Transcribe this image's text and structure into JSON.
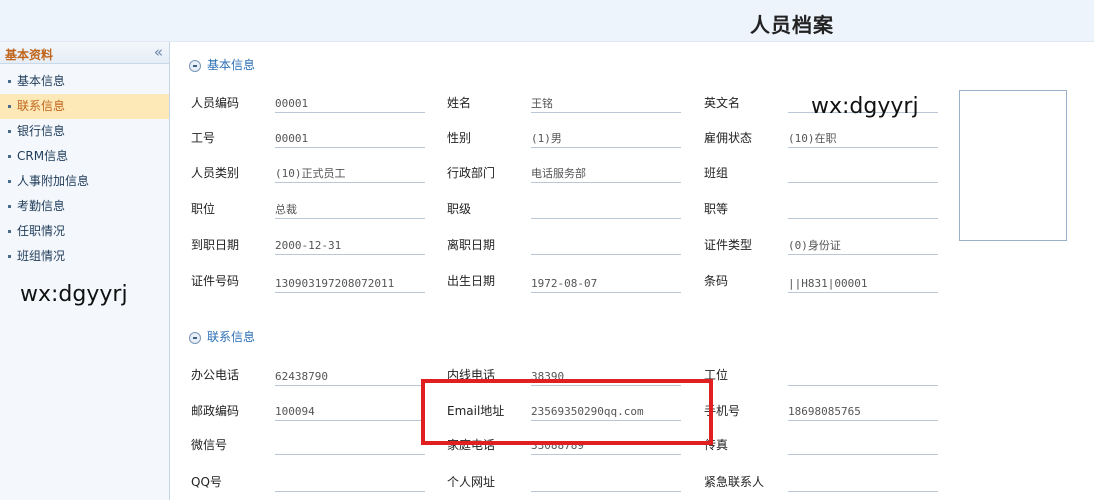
{
  "header": {
    "title": "人员档案"
  },
  "sidebar": {
    "title": "基本资料",
    "collapse_icon": "«",
    "items": [
      {
        "label": "基本信息",
        "active": false
      },
      {
        "label": "联系信息",
        "active": true
      },
      {
        "label": "银行信息",
        "active": false
      },
      {
        "label": "CRM信息",
        "active": false
      },
      {
        "label": "人事附加信息",
        "active": false
      },
      {
        "label": "考勤信息",
        "active": false
      },
      {
        "label": "任职情况",
        "active": false
      },
      {
        "label": "班组情况",
        "active": false
      }
    ],
    "watermark": "wx:dgyyrj"
  },
  "main": {
    "watermark": "wx:dgyyrj",
    "basic": {
      "title": "基本信息",
      "fields": {
        "emp_code": {
          "label": "人员编码",
          "value": "00001"
        },
        "name": {
          "label": "姓名",
          "value": "王铭"
        },
        "en_name": {
          "label": "英文名",
          "value": ""
        },
        "job_no": {
          "label": "工号",
          "value": "00001"
        },
        "gender": {
          "label": "性别",
          "value": "(1)男"
        },
        "emp_status": {
          "label": "雇佣状态",
          "value": "(10)在职"
        },
        "emp_type": {
          "label": "人员类别",
          "value": "(10)正式员工"
        },
        "dept": {
          "label": "行政部门",
          "value": "电话服务部"
        },
        "team": {
          "label": "班组",
          "value": ""
        },
        "position": {
          "label": "职位",
          "value": "总裁"
        },
        "rank": {
          "label": "职级",
          "value": ""
        },
        "grade": {
          "label": "职等",
          "value": ""
        },
        "hire_date": {
          "label": "到职日期",
          "value": "2000-12-31"
        },
        "leave_date": {
          "label": "离职日期",
          "value": ""
        },
        "id_type": {
          "label": "证件类型",
          "value": "(0)身份证"
        },
        "id_no": {
          "label": "证件号码",
          "value": "130903197208072011"
        },
        "birth": {
          "label": "出生日期",
          "value": "1972-08-07"
        },
        "barcode": {
          "label": "条码",
          "value": "||H831|00001"
        }
      }
    },
    "contact": {
      "title": "联系信息",
      "fields": {
        "office_phone": {
          "label": "办公电话",
          "value": "62438790"
        },
        "ext_phone": {
          "label": "内线电话",
          "value": "38390"
        },
        "workstation": {
          "label": "工位",
          "value": ""
        },
        "postcode": {
          "label": "邮政编码",
          "value": "100094"
        },
        "email": {
          "label": "Email地址",
          "value": "23569350290qq.com"
        },
        "mobile": {
          "label": "手机号",
          "value": "18698085765"
        },
        "wechat": {
          "label": "微信号",
          "value": ""
        },
        "home_phone": {
          "label": "家庭电话",
          "value": "33088789"
        },
        "fax": {
          "label": "传真",
          "value": ""
        },
        "qq": {
          "label": "QQ号",
          "value": ""
        },
        "homepage": {
          "label": "个人网址",
          "value": ""
        },
        "emergency": {
          "label": "紧急联系人",
          "value": ""
        }
      }
    }
  },
  "colors": {
    "highlight": "#e02020",
    "section_title": "#2c6fb5",
    "active_nav_bg": "#fde9b8"
  }
}
